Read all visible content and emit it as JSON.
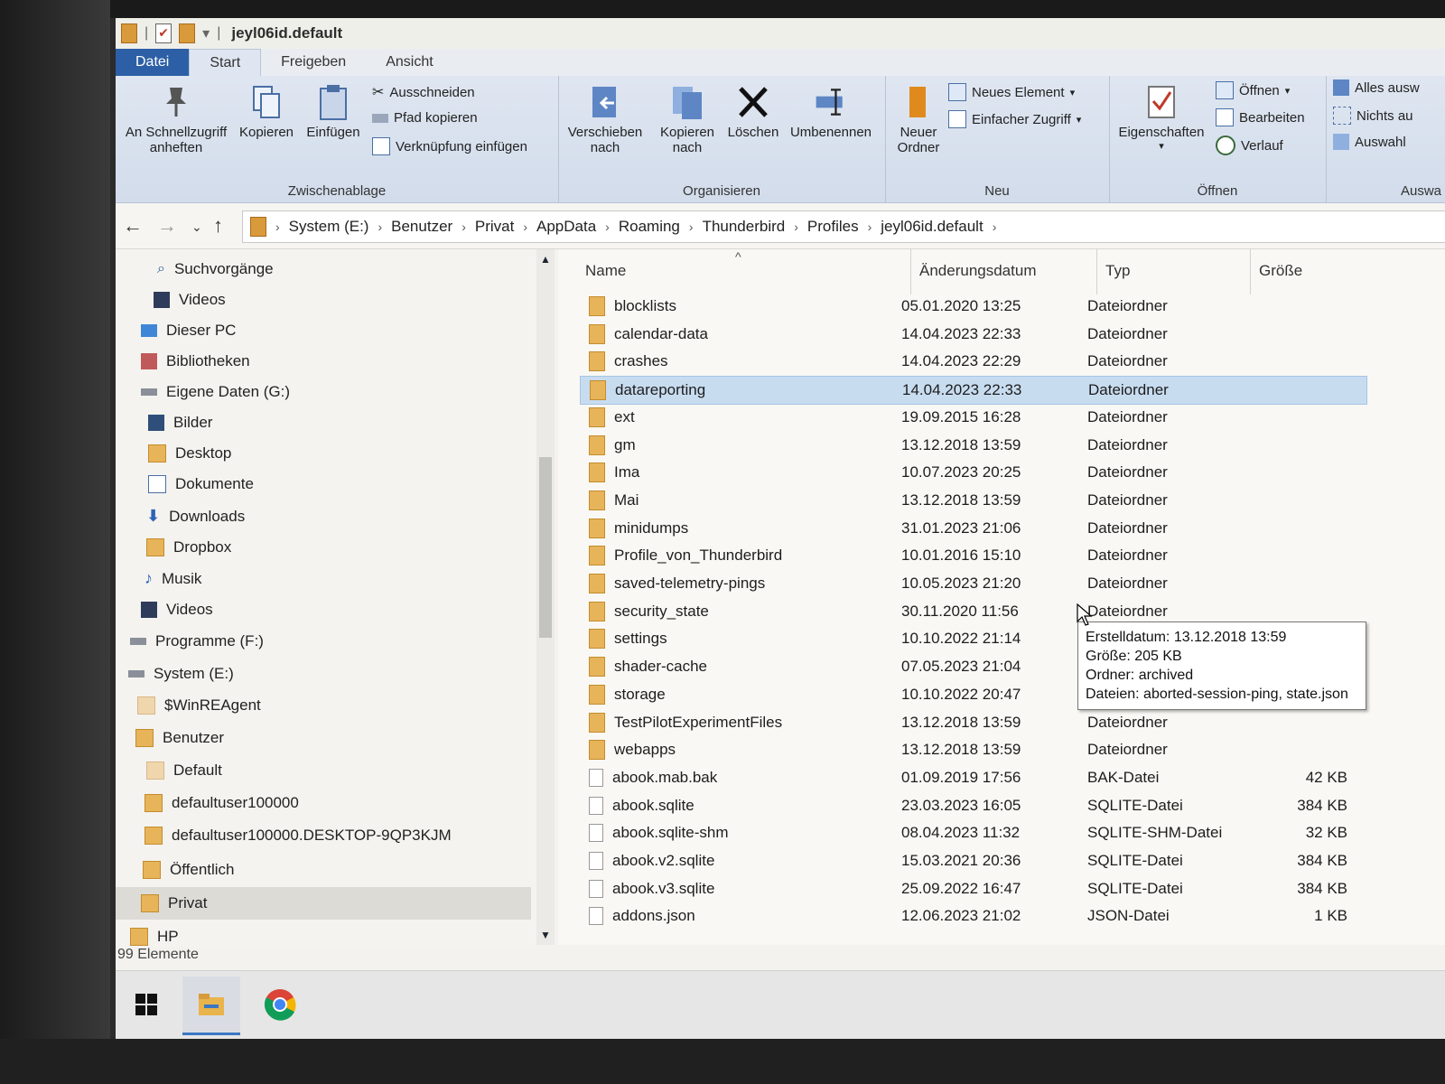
{
  "window": {
    "title": "jeyl06id.default"
  },
  "ribbon_tabs": [
    "Datei",
    "Start",
    "Freigeben",
    "Ansicht"
  ],
  "ribbon": {
    "clipboard": {
      "pin_label": "An Schnellzugriff anheften",
      "copy_label": "Kopieren",
      "paste_label": "Einfügen",
      "cut_label": "Ausschneiden",
      "copy_path_label": "Pfad kopieren",
      "paste_shortcut_label": "Verknüpfung einfügen",
      "group_label": "Zwischenablage"
    },
    "organize": {
      "move_label": "Verschieben nach",
      "copy_to_label": "Kopieren nach",
      "delete_label": "Löschen",
      "rename_label": "Umbenennen",
      "group_label": "Organisieren"
    },
    "new": {
      "new_folder_label": "Neuer Ordner",
      "new_item_label": "Neues Element",
      "easy_access_label": "Einfacher Zugriff",
      "group_label": "Neu"
    },
    "open": {
      "properties_label": "Eigenschaften",
      "open_label": "Öffnen",
      "edit_label": "Bearbeiten",
      "history_label": "Verlauf",
      "group_label": "Öffnen"
    },
    "select": {
      "select_all_label": "Alles ausw",
      "select_none_label": "Nichts au",
      "invert_label": "Auswahl",
      "group_label": "Auswa"
    }
  },
  "breadcrumb": [
    "System (E:)",
    "Benutzer",
    "Privat",
    "AppData",
    "Roaming",
    "Thunderbird",
    "Profiles",
    "jeyl06id.default"
  ],
  "nav_tree": [
    {
      "label": "Suchvorgänge",
      "icon": "search-icon"
    },
    {
      "label": "Videos",
      "icon": "video-icon"
    },
    {
      "label": "Dieser PC",
      "icon": "pc-icon"
    },
    {
      "label": "Bibliotheken",
      "icon": "library-icon"
    },
    {
      "label": "Eigene Daten (G:)",
      "icon": "drive-icon"
    },
    {
      "label": "Bilder",
      "icon": "pictures-icon"
    },
    {
      "label": "Desktop",
      "icon": "folder-icon"
    },
    {
      "label": "Dokumente",
      "icon": "documents-icon"
    },
    {
      "label": "Downloads",
      "icon": "download-icon"
    },
    {
      "label": "Dropbox",
      "icon": "folder-icon"
    },
    {
      "label": "Musik",
      "icon": "music-icon"
    },
    {
      "label": "Videos",
      "icon": "video-icon"
    },
    {
      "label": "Programme (F:)",
      "icon": "drive-icon"
    },
    {
      "label": "System (E:)",
      "icon": "drive-icon"
    },
    {
      "label": "$WinREAgent",
      "icon": "folder-light-icon"
    },
    {
      "label": "Benutzer",
      "icon": "folder-icon"
    },
    {
      "label": "Default",
      "icon": "folder-light-icon"
    },
    {
      "label": "defaultuser100000",
      "icon": "folder-icon"
    },
    {
      "label": "defaultuser100000.DESKTOP-9QP3KJM",
      "icon": "folder-icon"
    },
    {
      "label": "Öffentlich",
      "icon": "folder-icon"
    },
    {
      "label": "Privat",
      "icon": "folder-icon"
    },
    {
      "label": "HP",
      "icon": "folder-icon"
    }
  ],
  "columns": {
    "name": "Name",
    "date": "Änderungsdatum",
    "type": "Typ",
    "size": "Größe"
  },
  "files": [
    {
      "name": "blocklists",
      "date": "05.01.2020 13:25",
      "type": "Dateiordner",
      "size": "",
      "icon": "folder-icon"
    },
    {
      "name": "calendar-data",
      "date": "14.04.2023 22:33",
      "type": "Dateiordner",
      "size": "",
      "icon": "folder-icon"
    },
    {
      "name": "crashes",
      "date": "14.04.2023 22:29",
      "type": "Dateiordner",
      "size": "",
      "icon": "folder-icon"
    },
    {
      "name": "datareporting",
      "date": "14.04.2023 22:33",
      "type": "Dateiordner",
      "size": "",
      "icon": "folder-icon"
    },
    {
      "name": "ext",
      "date": "19.09.2015 16:28",
      "type": "Dateiordner",
      "size": "",
      "icon": "folder-icon"
    },
    {
      "name": "gm",
      "date": "13.12.2018 13:59",
      "type": "Dateiordner",
      "size": "",
      "icon": "folder-icon"
    },
    {
      "name": "Ima",
      "date": "10.07.2023 20:25",
      "type": "Dateiordner",
      "size": "",
      "icon": "folder-icon"
    },
    {
      "name": "Mai",
      "date": "13.12.2018 13:59",
      "type": "Dateiordner",
      "size": "",
      "icon": "folder-icon"
    },
    {
      "name": "minidumps",
      "date": "31.01.2023 21:06",
      "type": "Dateiordner",
      "size": "",
      "icon": "folder-icon"
    },
    {
      "name": "Profile_von_Thunderbird",
      "date": "10.01.2016 15:10",
      "type": "Dateiordner",
      "size": "",
      "icon": "folder-icon"
    },
    {
      "name": "saved-telemetry-pings",
      "date": "10.05.2023 21:20",
      "type": "Dateiordner",
      "size": "",
      "icon": "folder-icon"
    },
    {
      "name": "security_state",
      "date": "30.11.2020 11:56",
      "type": "Dateiordner",
      "size": "",
      "icon": "folder-icon"
    },
    {
      "name": "settings",
      "date": "10.10.2022 21:14",
      "type": "Dateiordner",
      "size": "",
      "icon": "folder-icon"
    },
    {
      "name": "shader-cache",
      "date": "07.05.2023 21:04",
      "type": "Dateiordner",
      "size": "",
      "icon": "folder-icon"
    },
    {
      "name": "storage",
      "date": "10.10.2022 20:47",
      "type": "Dateiordner",
      "size": "",
      "icon": "folder-icon"
    },
    {
      "name": "TestPilotExperimentFiles",
      "date": "13.12.2018 13:59",
      "type": "Dateiordner",
      "size": "",
      "icon": "folder-icon"
    },
    {
      "name": "webapps",
      "date": "13.12.2018 13:59",
      "type": "Dateiordner",
      "size": "",
      "icon": "folder-icon"
    },
    {
      "name": "abook.mab.bak",
      "date": "01.09.2019 17:56",
      "type": "BAK-Datei",
      "size": "42 KB",
      "icon": "file-icon"
    },
    {
      "name": "abook.sqlite",
      "date": "23.03.2023 16:05",
      "type": "SQLITE-Datei",
      "size": "384 KB",
      "icon": "file-icon"
    },
    {
      "name": "abook.sqlite-shm",
      "date": "08.04.2023 11:32",
      "type": "SQLITE-SHM-Datei",
      "size": "32 KB",
      "icon": "file-icon"
    },
    {
      "name": "abook.v2.sqlite",
      "date": "15.03.2021 20:36",
      "type": "SQLITE-Datei",
      "size": "384 KB",
      "icon": "file-icon"
    },
    {
      "name": "abook.v3.sqlite",
      "date": "25.09.2022 16:47",
      "type": "SQLITE-Datei",
      "size": "384 KB",
      "icon": "file-icon"
    },
    {
      "name": "addons.json",
      "date": "12.06.2023 21:02",
      "type": "JSON-Datei",
      "size": "1 KB",
      "icon": "file-icon"
    }
  ],
  "tooltip": {
    "line1": "Erstelldatum: 13.12.2018 13:59",
    "line2": "Größe: 205 KB",
    "line3": "Ordner: archived",
    "line4": "Dateien: aborted-session-ping, state.json"
  },
  "status": {
    "count": "99 Elemente"
  },
  "colors": {
    "file_tab": "#2c5fa6",
    "selection": "#c8dcf0",
    "folder": "#e7b45a"
  }
}
